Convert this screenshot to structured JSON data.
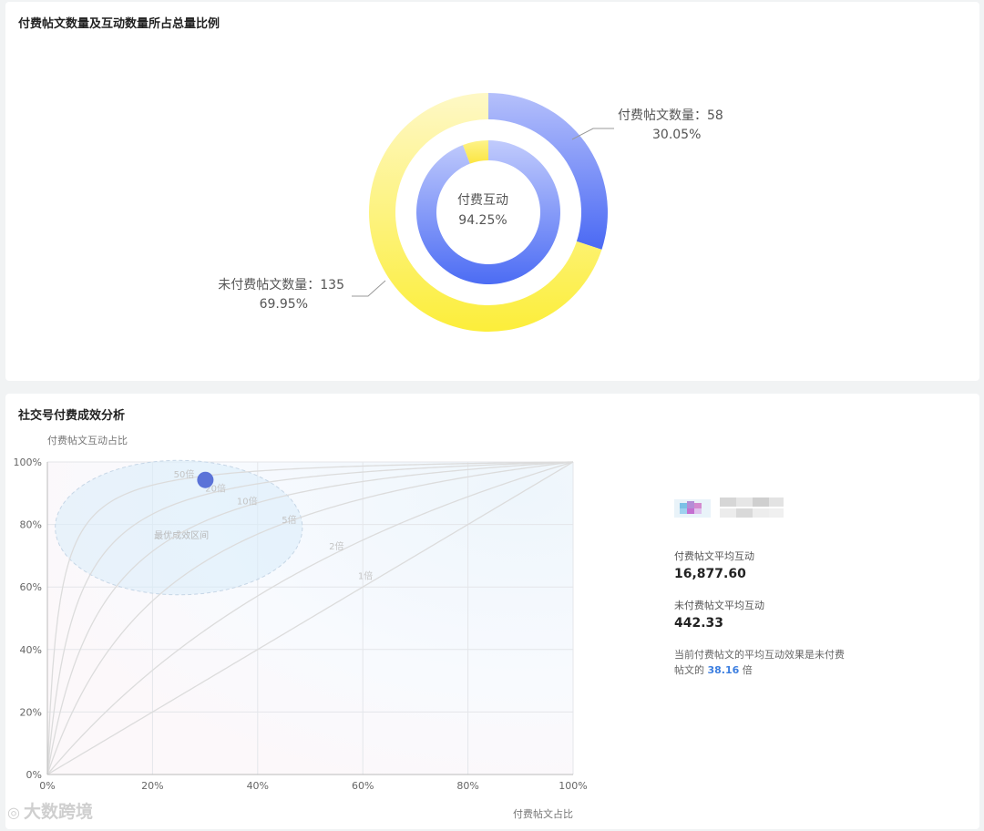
{
  "donut_card": {
    "title": "付费帖文数量及互动数量所占总量比例",
    "center_label": "付费互动",
    "center_value": "94.25%",
    "label_paid": "付费帖文数量：58",
    "label_paid_pct": "30.05%",
    "label_unpaid": "未付费帖文数量：135",
    "label_unpaid_pct": "69.95%"
  },
  "analysis_card": {
    "title": "社交号付费成效分析",
    "y_axis_title": "付费帖文互动占比",
    "x_axis_title": "付费帖文占比",
    "zone_label": "最优成效区间",
    "stats": {
      "paid_avg_label": "付费帖文平均互动",
      "paid_avg_value": "16,877.60",
      "unpaid_avg_label": "未付费帖文平均互动",
      "unpaid_avg_value": "442.33",
      "summary_prefix": "当前付费帖文的平均互动效果是未付费帖文的",
      "summary_multiplier": "38.16",
      "summary_suffix": "倍"
    }
  },
  "chart_data": [
    {
      "type": "pie",
      "title": "付费帖文数量及互动数量所占总量比例",
      "rings": [
        {
          "ring": "outer",
          "slices": [
            {
              "label": "付费帖文数量",
              "value": 58,
              "percent": 30.05
            },
            {
              "label": "未付费帖文数量",
              "value": 135,
              "percent": 69.95
            }
          ]
        },
        {
          "ring": "inner",
          "slices": [
            {
              "label": "付费互动",
              "percent": 94.25
            },
            {
              "label": "",
              "percent": 5.75
            }
          ]
        }
      ],
      "colors": {
        "paid": "#4f6ef5",
        "paid_light": "#b8c3fb",
        "unpaid": "#fbec3c",
        "unpaid_light": "#fef6bd"
      }
    },
    {
      "type": "scatter",
      "title": "社交号付费成效分析",
      "xlabel": "付费帖文占比",
      "ylabel": "付费帖文互动占比",
      "xlim": [
        0,
        100
      ],
      "ylim": [
        0,
        100
      ],
      "x_ticks": [
        "0%",
        "20%",
        "40%",
        "60%",
        "80%",
        "100%"
      ],
      "y_ticks": [
        "0%",
        "20%",
        "40%",
        "60%",
        "80%",
        "100%"
      ],
      "curves": [
        {
          "label": "50倍",
          "multiplier": 50
        },
        {
          "label": "20倍",
          "multiplier": 20
        },
        {
          "label": "10倍",
          "multiplier": 10
        },
        {
          "label": "5倍",
          "multiplier": 5
        },
        {
          "label": "2倍",
          "multiplier": 2
        },
        {
          "label": "1倍",
          "multiplier": 1
        }
      ],
      "point": {
        "x": 30.05,
        "y": 94.25
      },
      "grid": true
    }
  ],
  "watermark": "大数跨境"
}
